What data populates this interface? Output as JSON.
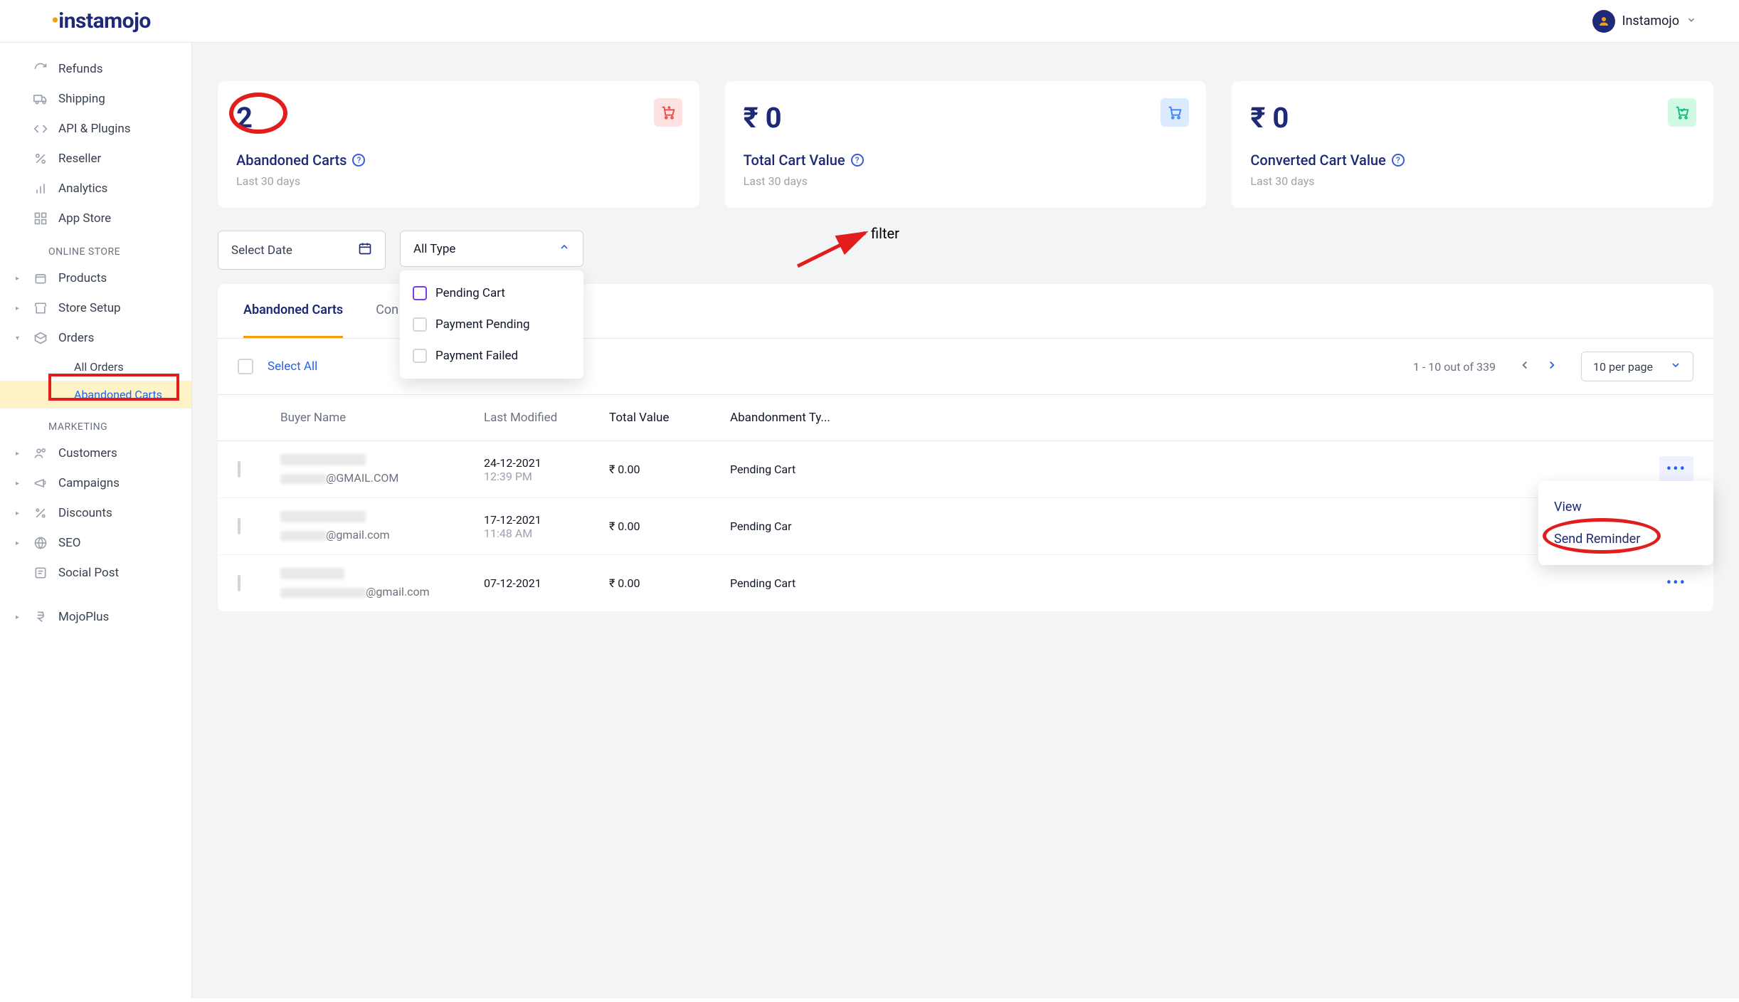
{
  "header": {
    "brand": "instamojo",
    "username": "Instamojo"
  },
  "sidebar": {
    "top": [
      {
        "label": "Refunds"
      },
      {
        "label": "Shipping"
      },
      {
        "label": "API & Plugins"
      },
      {
        "label": "Reseller"
      },
      {
        "label": "Analytics"
      },
      {
        "label": "App Store"
      }
    ],
    "section_online": "ONLINE STORE",
    "online": [
      {
        "label": "Products"
      },
      {
        "label": "Store Setup"
      },
      {
        "label": "Orders",
        "expanded": true
      }
    ],
    "orders_sub": [
      {
        "label": "All Orders"
      },
      {
        "label": "Abandoned Carts",
        "active": true
      }
    ],
    "section_marketing": "MARKETING",
    "marketing": [
      {
        "label": "Customers"
      },
      {
        "label": "Campaigns"
      },
      {
        "label": "Discounts"
      },
      {
        "label": "SEO"
      },
      {
        "label": "Social Post"
      }
    ],
    "mojoplus": "MojoPlus"
  },
  "stats": {
    "abandoned": {
      "value": "2",
      "label": "Abandoned Carts",
      "sub": "Last 30 days"
    },
    "total": {
      "value": "₹ 0",
      "label": "Total Cart Value",
      "sub": "Last 30 days"
    },
    "converted": {
      "value": "₹ 0",
      "label": "Converted Cart Value",
      "sub": "Last 30 days"
    }
  },
  "filters": {
    "date": "Select Date",
    "type": "All Type",
    "type_options": [
      "Pending Cart",
      "Payment Pending",
      "Payment Failed"
    ],
    "annotation": "filter"
  },
  "tabs": {
    "abandoned": "Abandoned Carts",
    "converted": "Con"
  },
  "controls": {
    "select_all": "Select All",
    "page_count": "1 - 10 out of 339",
    "per_page": "10 per page"
  },
  "columns": {
    "buyer": "Buyer Name",
    "modified": "Last Modified",
    "value": "Total Value",
    "type": "Abandonment Ty..."
  },
  "rows": [
    {
      "email_suffix": "@GMAIL.COM",
      "date": "24-12-2021",
      "time": "12:39 PM",
      "value": "₹ 0.00",
      "type": "Pending Cart"
    },
    {
      "email_suffix": "@gmail.com",
      "date": "17-12-2021",
      "time": "11:48 AM",
      "value": "₹ 0.00",
      "type": "Pending Car"
    },
    {
      "email_suffix": "@gmail.com",
      "date": "07-12-2021",
      "time": "",
      "value": "₹ 0.00",
      "type": "Pending Cart"
    }
  ],
  "action_menu": {
    "view": "View",
    "send": "Send Reminder"
  }
}
